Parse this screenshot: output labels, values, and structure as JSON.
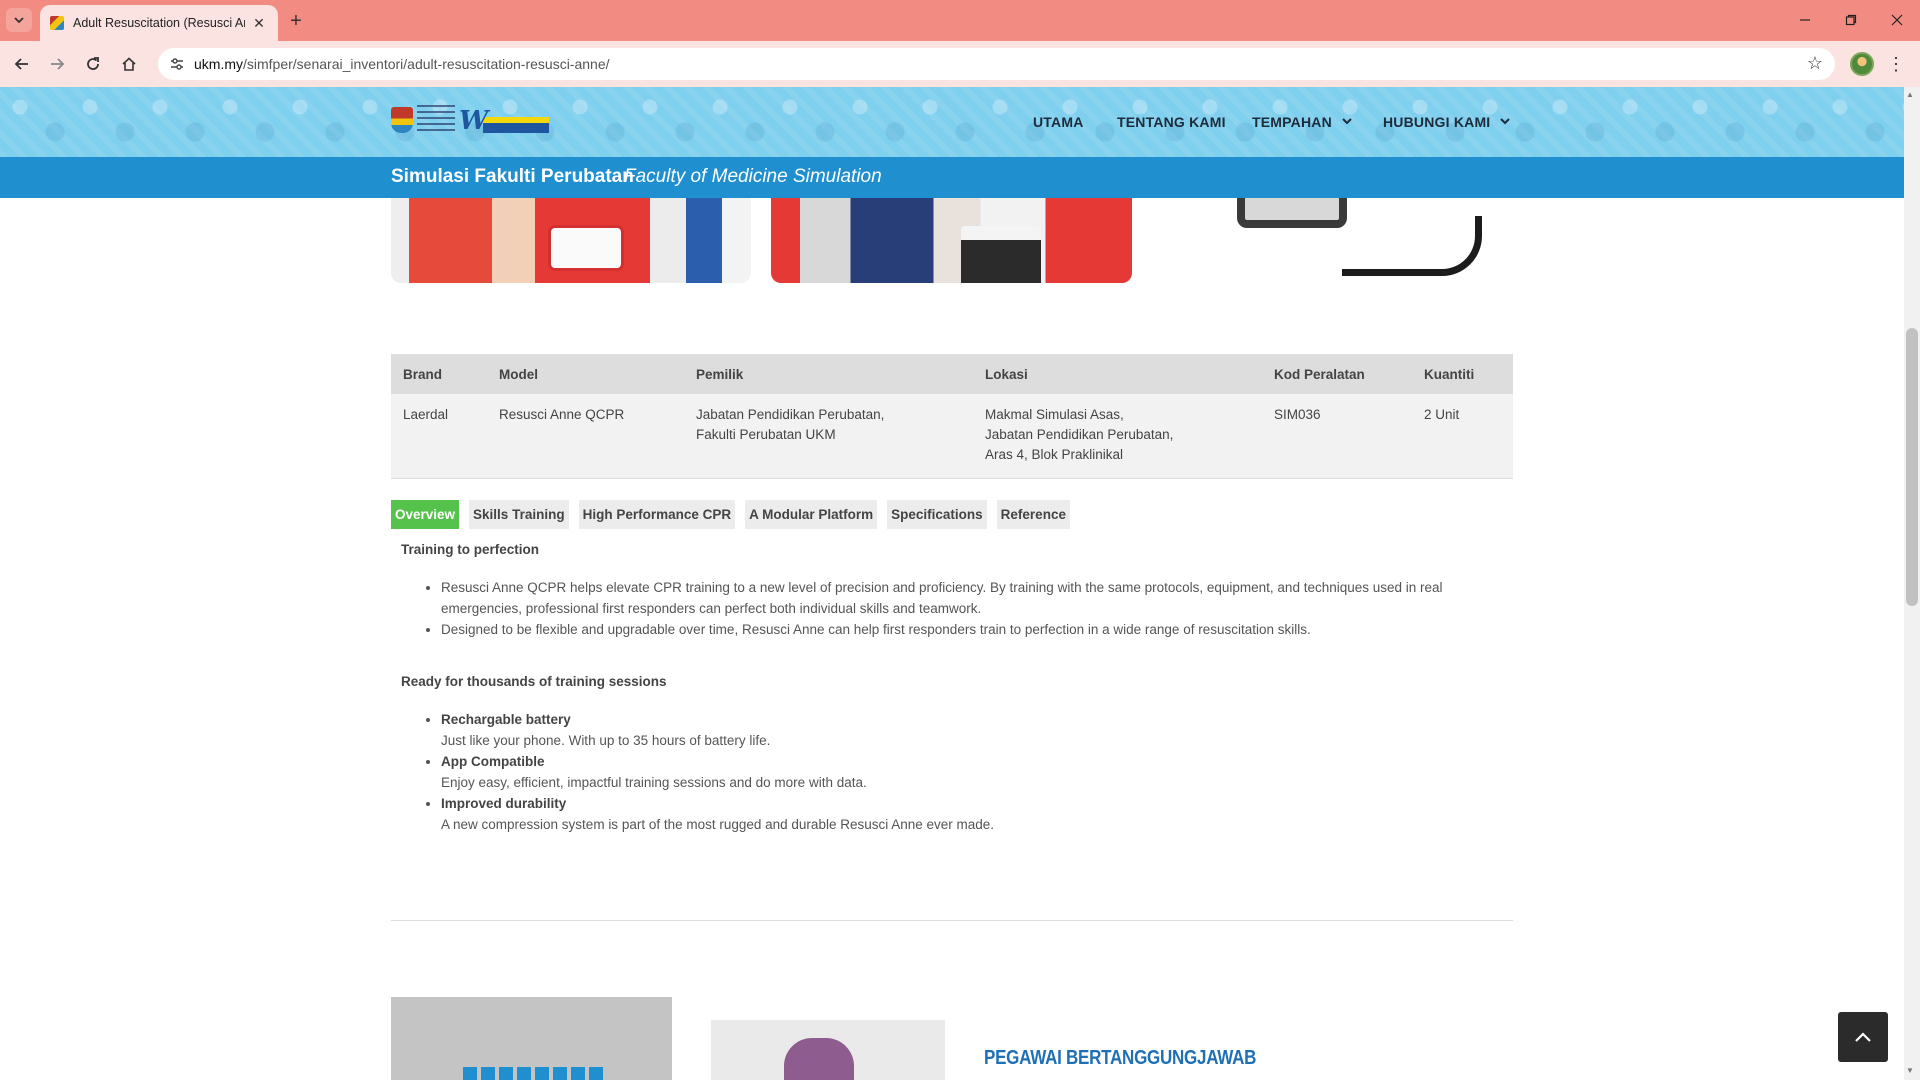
{
  "browser": {
    "tab_title": "Adult Resuscitation (Resusci Anne",
    "url_host": "ukm.my",
    "url_path": "/simfper/senarai_inventori/adult-resuscitation-resusci-anne/",
    "icons": {
      "tab_list": "chevron-down-icon",
      "close": "close-icon",
      "new_tab": "plus-icon",
      "back": "back-arrow-icon",
      "forward": "forward-arrow-icon",
      "reload": "reload-icon",
      "home": "home-icon",
      "site_info": "tune-icon",
      "bookmark": "star-icon",
      "menu": "more-vert-icon"
    }
  },
  "header": {
    "nav": [
      {
        "label": "UTAMA"
      },
      {
        "label": "TENTANG KAMI"
      },
      {
        "label": "TEMPAHAN",
        "has_dropdown": true
      },
      {
        "label": "HUBUNGI KAMI",
        "has_dropdown": true
      }
    ],
    "site_title": "Simulasi Fakulti Perubatan",
    "site_subtitle": "Faculty of Medicine Simulation"
  },
  "equipment_table": {
    "columns": [
      "Brand",
      "Model",
      "Pemilik",
      "Lokasi",
      "Kod Peralatan",
      "Kuantiti"
    ],
    "row": {
      "brand": "Laerdal",
      "model": "Resusci Anne QCPR",
      "pemilik": [
        "Jabatan Pendidikan Perubatan,",
        "Fakulti Perubatan UKM"
      ],
      "lokasi": [
        "Makmal Simulasi Asas,",
        "Jabatan Pendidikan Perubatan,",
        "Aras 4, Blok Praklinikal"
      ],
      "kod": "SIM036",
      "kuantiti": "2 Unit"
    }
  },
  "tabs": [
    {
      "label": "Overview",
      "active": true
    },
    {
      "label": "Skills Training"
    },
    {
      "label": "High Performance CPR"
    },
    {
      "label": "A Modular Platform"
    },
    {
      "label": "Specifications"
    },
    {
      "label": "Reference"
    }
  ],
  "overview": {
    "section1_title": "Training to perfection",
    "section1_bullets": [
      "Resusci Anne QCPR helps elevate CPR training to a new level of precision and proficiency. By training with the same protocols, equipment, and techniques used in real emergencies, professional first responders can perfect both individual skills and teamwork.",
      "Designed to be flexible and upgradable over time, Resusci Anne can help first responders train to perfection in a wide range of resuscitation skills."
    ],
    "section2_title": "Ready for thousands of training sessions",
    "section2_items": [
      {
        "title": "Rechargable battery",
        "text": "Just like your phone. With up to 35 hours of battery life."
      },
      {
        "title": "App Compatible",
        "text": "Enjoy easy, efficient, impactful training sessions and do more with data."
      },
      {
        "title": "Improved durability",
        "text": "A new compression system is part of the most rugged and durable Resusci Anne ever made."
      }
    ]
  },
  "staff": {
    "heading": "PEGAWAI BERTANGGUNGJAWAB"
  },
  "colors": {
    "tab_bar": "#f28b82",
    "header_bg": "#7fcfee",
    "subheader_bg": "#1f8fcf",
    "active_tab": "#55c24b",
    "staff_heading": "#1f6fb5"
  }
}
